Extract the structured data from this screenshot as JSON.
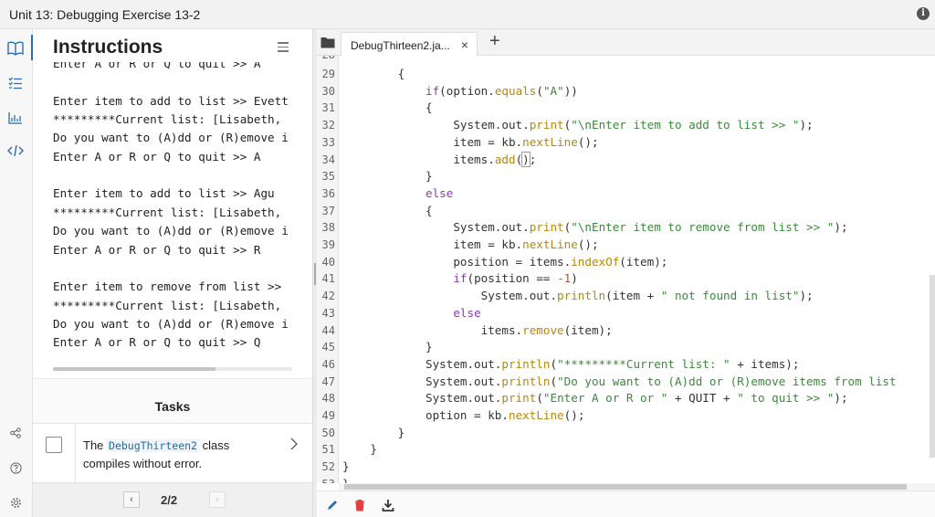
{
  "window": {
    "title": "Unit 13: Debugging Exercise 13-2",
    "info_glyph": "i"
  },
  "rail": {
    "items": [
      {
        "name": "book-icon",
        "active": true
      },
      {
        "name": "checklist-icon",
        "active": false
      },
      {
        "name": "chart-icon",
        "active": false
      },
      {
        "name": "code-icon",
        "active": false
      }
    ],
    "bottom": [
      "share-icon",
      "help-icon",
      "settings-icon"
    ]
  },
  "instructions": {
    "heading": "Instructions",
    "console_lines": [
      "Enter A or R or Q to quit >> A",
      "",
      "Enter item to add to list >> Evett",
      "*********Current list: [Lisabeth,",
      "Do you want to (A)dd or (R)emove i",
      "Enter A or R or Q to quit >> A",
      "",
      "Enter item to add to list >> Agu",
      "*********Current list: [Lisabeth,",
      "Do you want to (A)dd or (R)emove i",
      "Enter A or R or Q to quit >> R",
      "",
      "Enter item to remove from list >>",
      "*********Current list: [Lisabeth,",
      "Do you want to (A)dd or (R)emove i",
      "Enter A or R or Q to quit >> Q"
    ]
  },
  "tasks": {
    "heading": "Tasks",
    "items": [
      {
        "prefix": "The",
        "code": "DebugThirteen2",
        "suffix": "class",
        "line2": "compiles without error."
      }
    ]
  },
  "pager": {
    "label": "2/2",
    "prev": "‹",
    "next": "›"
  },
  "editor": {
    "tab_name": "DebugThirteen2.ja...",
    "close_glyph": "×",
    "plus_glyph": "+",
    "first_line_number": 29,
    "lines": [
      [
        {
          "t": "        {"
        }
      ],
      [
        {
          "t": "            "
        },
        {
          "t": "if",
          "c": "kw"
        },
        {
          "t": "(option."
        },
        {
          "t": "equals",
          "c": "fn"
        },
        {
          "t": "("
        },
        {
          "t": "\"A\"",
          "c": "str"
        },
        {
          "t": "))"
        }
      ],
      [
        {
          "t": "            {"
        }
      ],
      [
        {
          "t": "                System.out."
        },
        {
          "t": "print",
          "c": "fn"
        },
        {
          "t": "("
        },
        {
          "t": "\"\\nEnter item to add to list >> \"",
          "c": "str"
        },
        {
          "t": ");"
        }
      ],
      [
        {
          "t": "                item = kb."
        },
        {
          "t": "nextLine",
          "c": "fn"
        },
        {
          "t": "();"
        }
      ],
      [
        {
          "t": "                items."
        },
        {
          "t": "add",
          "c": "fn"
        },
        {
          "t": "("
        },
        {
          "t": ")",
          "c": "hl"
        },
        {
          "t": ";"
        }
      ],
      [
        {
          "t": "            }"
        }
      ],
      [
        {
          "t": "            "
        },
        {
          "t": "else",
          "c": "kw"
        }
      ],
      [
        {
          "t": "            {"
        }
      ],
      [
        {
          "t": "                System.out."
        },
        {
          "t": "print",
          "c": "fn"
        },
        {
          "t": "("
        },
        {
          "t": "\"\\nEnter item to remove from list >> \"",
          "c": "str"
        },
        {
          "t": ");"
        }
      ],
      [
        {
          "t": "                item = kb."
        },
        {
          "t": "nextLine",
          "c": "fn"
        },
        {
          "t": "();"
        }
      ],
      [
        {
          "t": "                position = items."
        },
        {
          "t": "indexOf",
          "c": "fn"
        },
        {
          "t": "(item);"
        }
      ],
      [
        {
          "t": "                "
        },
        {
          "t": "if",
          "c": "kw"
        },
        {
          "t": "(position == "
        },
        {
          "t": "-1",
          "c": "num"
        },
        {
          "t": ")"
        }
      ],
      [
        {
          "t": "                    System.out."
        },
        {
          "t": "println",
          "c": "fn"
        },
        {
          "t": "(item + "
        },
        {
          "t": "\" not found in list\"",
          "c": "str"
        },
        {
          "t": ");"
        }
      ],
      [
        {
          "t": "                "
        },
        {
          "t": "else",
          "c": "kw"
        }
      ],
      [
        {
          "t": "                    items."
        },
        {
          "t": "remove",
          "c": "fn"
        },
        {
          "t": "(item);"
        }
      ],
      [
        {
          "t": "            }"
        }
      ],
      [
        {
          "t": "            System.out."
        },
        {
          "t": "println",
          "c": "fn"
        },
        {
          "t": "("
        },
        {
          "t": "\"*********Current list: \"",
          "c": "str"
        },
        {
          "t": " + items);"
        }
      ],
      [
        {
          "t": "            System.out."
        },
        {
          "t": "println",
          "c": "fn"
        },
        {
          "t": "("
        },
        {
          "t": "\"Do you want to (A)dd or (R)emove items from list",
          "c": "str"
        }
      ],
      [
        {
          "t": "            System.out."
        },
        {
          "t": "print",
          "c": "fn"
        },
        {
          "t": "("
        },
        {
          "t": "\"Enter A or R or \"",
          "c": "str"
        },
        {
          "t": " + QUIT + "
        },
        {
          "t": "\" to quit >> \"",
          "c": "str"
        },
        {
          "t": ");"
        }
      ],
      [
        {
          "t": "            option = kb."
        },
        {
          "t": "nextLine",
          "c": "fn"
        },
        {
          "t": "();"
        }
      ],
      [
        {
          "t": "        }"
        }
      ],
      [
        {
          "t": "    }"
        }
      ],
      [
        {
          "t": "}"
        }
      ],
      [
        {
          "t": "}"
        }
      ]
    ]
  },
  "colors": {
    "accent": "#2b6cb0",
    "keyword": "#8a3bb3",
    "method": "#b8860b",
    "string": "#3a8a3a",
    "number": "#b9533a",
    "delete": "#e53e3e"
  }
}
